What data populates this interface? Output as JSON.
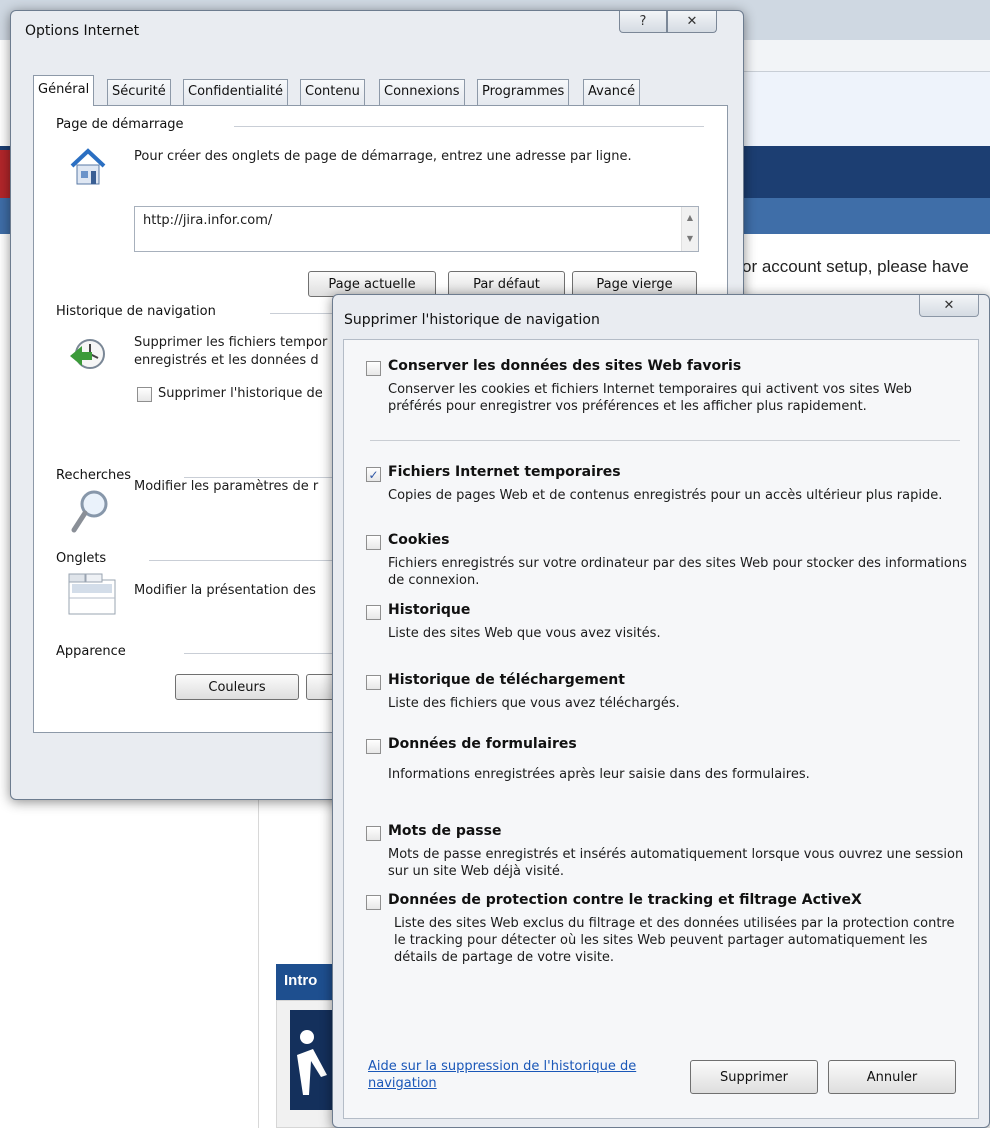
{
  "background": {
    "partial_text": "or account setup, please have",
    "intro_label": "Intro"
  },
  "options_dialog": {
    "title": "Options Internet",
    "help_glyph": "?",
    "close_glyph": "✕",
    "tabs": [
      {
        "label": "Général"
      },
      {
        "label": "Sécurité"
      },
      {
        "label": "Confidentialité"
      },
      {
        "label": "Contenu"
      },
      {
        "label": "Connexions"
      },
      {
        "label": "Programmes"
      },
      {
        "label": "Avancé"
      }
    ],
    "startup": {
      "heading": "Page de démarrage",
      "description": "Pour créer des onglets de page de démarrage, entrez une adresse par ligne.",
      "url_value": "http://jira.infor.com/",
      "btn_current": "Page actuelle",
      "btn_default": "Par défaut",
      "btn_blank": "Page vierge"
    },
    "history": {
      "heading": "Historique de navigation",
      "description_line1": "Supprimer les fichiers tempor",
      "description_line2": "enregistrés et les données d",
      "checkbox_label": "Supprimer l'historique de"
    },
    "search": {
      "heading": "Recherches",
      "description": "Modifier les paramètres de r"
    },
    "tabs_section": {
      "heading": "Onglets",
      "description": "Modifier la présentation des"
    },
    "appearance": {
      "heading": "Apparence",
      "btn_colors": "Couleurs"
    }
  },
  "delete_dialog": {
    "title": "Supprimer l'historique de navigation",
    "close_glyph": "✕",
    "items": [
      {
        "title": "Conserver les données des sites Web favoris",
        "description": "Conserver les cookies et fichiers Internet temporaires qui activent vos sites Web préférés pour enregistrer vos préférences et les afficher plus rapidement.",
        "checked": false
      },
      {
        "title": "Fichiers Internet temporaires",
        "description": "Copies de pages Web et de contenus enregistrés pour un accès ultérieur plus rapide.",
        "checked": true
      },
      {
        "title": "Cookies",
        "description": "Fichiers enregistrés sur votre ordinateur par des sites Web pour stocker des informations de connexion.",
        "checked": false
      },
      {
        "title": "Historique",
        "description": "Liste des sites Web que vous avez visités.",
        "checked": false
      },
      {
        "title": "Historique de téléchargement",
        "description": "Liste des fichiers que vous avez téléchargés.",
        "checked": false
      },
      {
        "title": "Données de formulaires",
        "description": "Informations enregistrées après leur saisie dans des formulaires.",
        "checked": false
      },
      {
        "title": "Mots de passe",
        "description": "Mots de passe enregistrés et insérés automatiquement lorsque vous ouvrez une session sur un site Web déjà visité.",
        "checked": false
      },
      {
        "title": "Données de protection contre le tracking et filtrage ActiveX",
        "description": "Liste des sites Web exclus du filtrage et des données utilisées par la protection contre le tracking pour détecter où les sites Web peuvent partager automatiquement les détails de partage de votre visite.",
        "checked": false
      }
    ],
    "help_link": "Aide sur la suppression de l'historique de navigation",
    "btn_delete": "Supprimer",
    "btn_cancel": "Annuler",
    "check_glyph": "✓"
  },
  "icons": {
    "home": "house-icon",
    "history": "clock-arrow-icon",
    "search": "magnifier-icon",
    "tabs": "tabs-window-icon"
  }
}
